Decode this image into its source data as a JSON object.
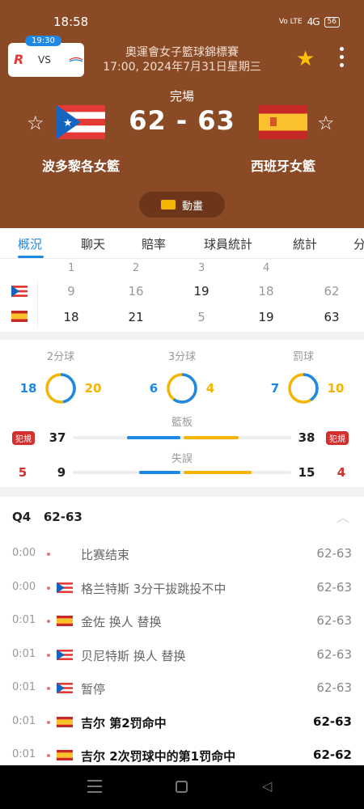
{
  "status_bar": {
    "time": "18:58",
    "network": "Vo LTE",
    "signal": "4G",
    "battery": "56"
  },
  "mini_match": {
    "time": "19:30",
    "vs": "VS"
  },
  "competition": {
    "title": "奧運會女子籃球錦標賽",
    "date": "17:00, 2024年7月31日星期三"
  },
  "match": {
    "status": "完場",
    "score": "62 - 63",
    "home_team": "波多黎各女籃",
    "away_team": "西班牙女籃",
    "animation_label": "動畫"
  },
  "tabs": [
    "概況",
    "聊天",
    "賠率",
    "球員統計",
    "統計",
    "分"
  ],
  "quarters": {
    "headers": [
      "1",
      "2",
      "3",
      "4"
    ],
    "home": [
      "9",
      "16",
      "19",
      "18",
      "62"
    ],
    "away": [
      "18",
      "21",
      "5",
      "19",
      "63"
    ]
  },
  "stats": {
    "two_pt": {
      "label": "2分球",
      "home": "18",
      "away": "20",
      "home_fraction": 0.47
    },
    "three_pt": {
      "label": "3分球",
      "home": "6",
      "away": "4",
      "home_fraction": 0.6
    },
    "free_throws": {
      "label": "罰球",
      "home": "7",
      "away": "10",
      "home_fraction": 0.41
    },
    "rebounds": {
      "label": "籃板",
      "home": "37",
      "away": "38"
    },
    "turnovers": {
      "label": "失誤",
      "home": "9",
      "away": "15"
    },
    "fouls": {
      "label": "犯規",
      "home": "5",
      "away": "4"
    }
  },
  "pbp": {
    "title": "Q4   62-63",
    "rows": [
      {
        "time": "0:00",
        "team": "",
        "text": "比赛结束",
        "score": "62-63",
        "bold": false
      },
      {
        "time": "0:00",
        "team": "pr",
        "text": "格兰特斯 3分干拔跳投不中",
        "score": "62-63",
        "bold": false
      },
      {
        "time": "0:01",
        "team": "es",
        "text": "金佐 换人 替换",
        "score": "62-63",
        "bold": false
      },
      {
        "time": "0:01",
        "team": "pr",
        "text": "贝尼特斯 换人 替换",
        "score": "62-63",
        "bold": false
      },
      {
        "time": "0:01",
        "team": "pr",
        "text": "暂停",
        "score": "62-63",
        "bold": false
      },
      {
        "time": "0:01",
        "team": "es",
        "text": "吉尔 第2罚命中",
        "score": "62-63",
        "bold": true
      },
      {
        "time": "0:01",
        "team": "es",
        "text": "吉尔 2次罚球中的第1罚命中",
        "score": "62-62",
        "bold": true
      }
    ]
  },
  "colors": {
    "header_bg": "#8a4a26",
    "accent_blue": "#1e88e5",
    "accent_gold": "#f4b400",
    "foul_red": "#d32f2f"
  }
}
